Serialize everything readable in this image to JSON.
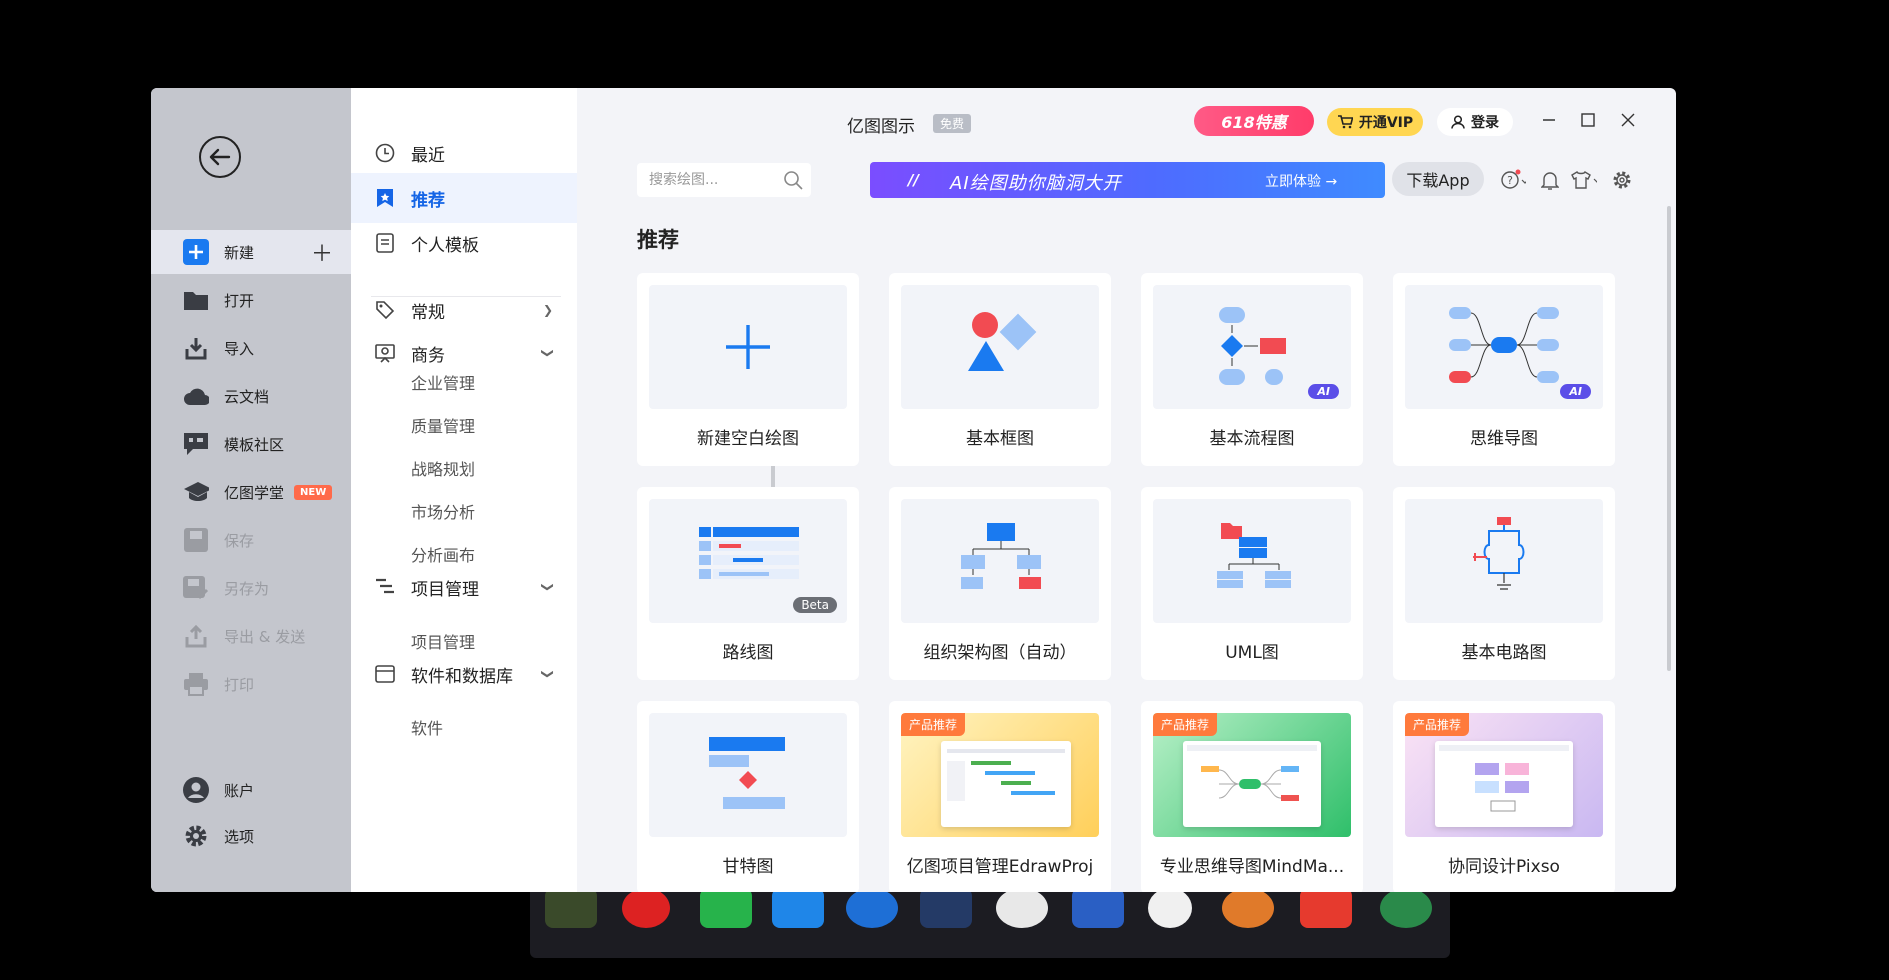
{
  "window": {
    "title": "亿图图示",
    "free_badge": "免费",
    "promo_label": "618特惠",
    "vip_label": "开通VIP",
    "login_label": "登录"
  },
  "left_menu": {
    "items": [
      {
        "label": "新建"
      },
      {
        "label": "打开"
      },
      {
        "label": "导入"
      },
      {
        "label": "云文档"
      },
      {
        "label": "模板社区"
      },
      {
        "label": "亿图学堂",
        "badge": "NEW"
      },
      {
        "label": "保存"
      },
      {
        "label": "另存为"
      },
      {
        "label": "导出 & 发送"
      },
      {
        "label": "打印"
      }
    ],
    "bottom": [
      {
        "label": "账户"
      },
      {
        "label": "选项"
      }
    ]
  },
  "categories": {
    "top": [
      {
        "label": "最近"
      },
      {
        "label": "推荐"
      },
      {
        "label": "个人模板"
      }
    ],
    "groups": [
      {
        "label": "常规"
      },
      {
        "label": "商务"
      },
      {
        "label": "项目管理"
      },
      {
        "label": "软件和数据库"
      }
    ],
    "business_subs": [
      "企业管理",
      "质量管理",
      "战略规划",
      "市场分析",
      "分析画布"
    ],
    "project_subs": [
      "项目管理"
    ],
    "software_subs": [
      "软件"
    ]
  },
  "toolbar": {
    "search_placeholder": "搜索绘图...",
    "ai_banner_logo": "//",
    "ai_banner_text": "AI绘图助你脑洞大开",
    "ai_banner_cta": "立即体验 →",
    "download_label": "下载App"
  },
  "section_title": "推荐",
  "cards": [
    {
      "label": "新建空白绘图"
    },
    {
      "label": "基本框图"
    },
    {
      "label": "基本流程图",
      "tag": "AI"
    },
    {
      "label": "思维导图",
      "tag": "AI"
    },
    {
      "label": "路线图",
      "tag": "Beta"
    },
    {
      "label": "组织架构图（自动）"
    },
    {
      "label": "UML图"
    },
    {
      "label": "基本电路图"
    },
    {
      "label": "甘特图"
    },
    {
      "label": "亿图项目管理EdrawProj",
      "tag": "产品推荐"
    },
    {
      "label": "专业思维导图MindMa...",
      "tag": "产品推荐"
    },
    {
      "label": "协同设计Pixso",
      "tag": "产品推荐"
    }
  ],
  "colors": {
    "accent": "#1565e6",
    "shape_red": "#f24b52",
    "shape_blue": "#1a7af0",
    "shape_lightblue": "#9cc3f7",
    "vip_yellow": "#ffd652",
    "promo_pink": "#ff4f7d"
  }
}
